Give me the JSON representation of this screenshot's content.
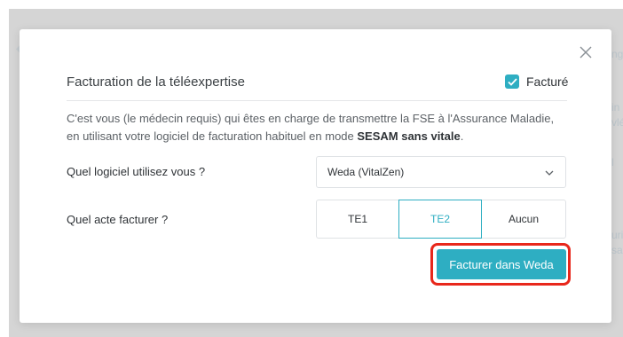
{
  "background": {
    "right_fragments": [
      "ng",
      "in",
      "vlé",
      "l",
      "uri",
      "sai"
    ]
  },
  "modal": {
    "title": "Facturation de la téléexpertise",
    "billed_label": "Facturé",
    "billed_checked": true,
    "description_part1": "C'est vous (le médecin requis) qui êtes en charge de transmettre la FSE à l'Assurance Maladie,",
    "description_part2": "en utilisant votre logiciel de facturation habituel en mode ",
    "description_bold": "SESAM sans vitale",
    "description_end": ".",
    "software_question": "Quel logiciel utilisez vous ?",
    "software_selected": "Weda (VitalZen)",
    "act_question": "Quel acte facturer ?",
    "act_options": [
      "TE1",
      "TE2",
      "Aucun"
    ],
    "act_selected": "TE2",
    "action_button": "Facturer dans Weda"
  },
  "colors": {
    "accent": "#2eaec2",
    "highlight": "#e8271b",
    "text": "#2f3337",
    "muted": "#5c6166"
  }
}
